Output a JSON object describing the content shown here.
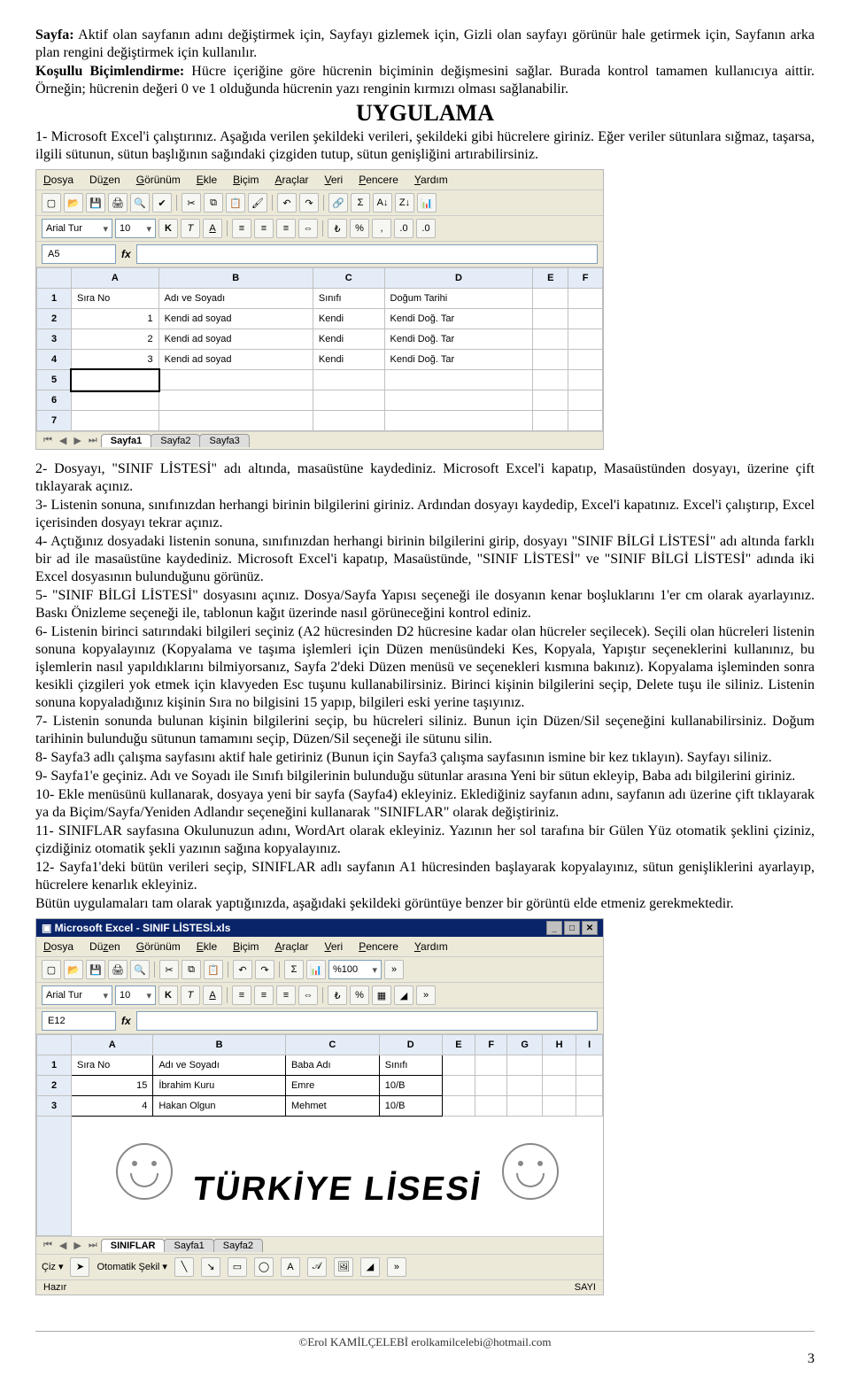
{
  "intro": {
    "p1_a": "Sayfa:",
    "p1_b": " Aktif olan sayfanın adını değiştirmek için, Sayfayı gizlemek için, Gizli olan sayfayı görünür hale getirmek için, Sayfanın arka plan rengini değiştirmek için kullanılır.",
    "p2_a": "Koşullu Biçimlendirme:",
    "p2_b": " Hücre içeriğine göre hücrenin biçiminin değişmesini sağlar. Burada kontrol tamamen kullanıcıya aittir. Örneğin; hücrenin değeri 0 ve 1 olduğunda hücrenin yazı renginin kırmızı olması sağlanabilir."
  },
  "uyg_title": "UYGULAMA",
  "uyg_p1": "1- Microsoft Excel'i çalıştırınız. Aşağıda verilen şekildeki verileri, şekildeki gibi hücrelere giriniz. Eğer veriler sütunlara sığmaz, taşarsa, ilgili sütunun, sütun başlığının sağındaki çizgiden tutup, sütun genişliğini artırabilirsiniz.",
  "excel1": {
    "menus": [
      "Dosya",
      "Düzen",
      "Görünüm",
      "Ekle",
      "Biçim",
      "Araçlar",
      "Veri",
      "Pencere",
      "Yardım"
    ],
    "font": "Arial Tur",
    "size": "10",
    "cellref": "A5",
    "fx": "fx",
    "cols": [
      "A",
      "B",
      "C",
      "D",
      "E",
      "F"
    ],
    "rows": [
      [
        "1",
        "Sıra No",
        "Adı ve Soyadı",
        "Sınıfı",
        "Doğum Tarihi",
        "",
        ""
      ],
      [
        "2",
        "1",
        "Kendi ad soyad",
        "Kendi",
        "Kendi Doğ. Tar",
        "",
        ""
      ],
      [
        "3",
        "2",
        "Kendi ad soyad",
        "Kendi",
        "Kendi Doğ. Tar",
        "",
        ""
      ],
      [
        "4",
        "3",
        "Kendi ad soyad",
        "Kendi",
        "Kendi Doğ. Tar",
        "",
        ""
      ],
      [
        "5",
        "",
        "",
        "",
        "",
        "",
        ""
      ],
      [
        "6",
        "",
        "",
        "",
        "",
        "",
        ""
      ],
      [
        "7",
        "",
        "",
        "",
        "",
        "",
        ""
      ]
    ],
    "tabs": [
      "Sayfa1",
      "Sayfa2",
      "Sayfa3"
    ]
  },
  "paras": {
    "p2": "2- Dosyayı, \"SINIF LİSTESİ\" adı altında, masaüstüne kaydediniz. Microsoft Excel'i kapatıp, Masaüstünden dosyayı, üzerine çift tıklayarak açınız.",
    "p3": "3- Listenin sonuna, sınıfınızdan herhangi birinin bilgilerini giriniz. Ardından dosyayı kaydedip, Excel'i kapatınız. Excel'i çalıştırıp, Excel içerisinden dosyayı tekrar açınız.",
    "p4": "4- Açtığınız dosyadaki listenin sonuna, sınıfınızdan herhangi birinin bilgilerini girip, dosyayı \"SINIF BİLGİ LİSTESİ\" adı altında farklı bir ad ile masaüstüne kaydediniz. Microsoft Excel'i kapatıp, Masaüstünde, \"SINIF LİSTESİ\" ve \"SINIF BİLGİ LİSTESİ\" adında iki Excel dosyasının bulunduğunu görünüz.",
    "p5": "5- \"SINIF BİLGİ LİSTESİ\" dosyasını açınız. Dosya/Sayfa Yapısı seçeneği ile dosyanın kenar boşluklarını 1'er cm olarak ayarlayınız. Baskı Önizleme seçeneği ile, tablonun kağıt üzerinde nasıl görüneceğini kontrol ediniz.",
    "p6": "6- Listenin birinci satırındaki bilgileri seçiniz (A2 hücresinden D2 hücresine kadar olan hücreler seçilecek). Seçili olan hücreleri listenin sonuna kopyalayınız (Kopyalama ve taşıma işlemleri için Düzen menüsündeki Kes, Kopyala, Yapıştır seçeneklerini kullanınız, bu işlemlerin nasıl yapıldıklarını bilmiyorsanız, Sayfa 2'deki Düzen menüsü ve seçenekleri kısmına bakınız). Kopyalama işleminden sonra kesikli çizgileri yok etmek için klavyeden Esc tuşunu kullanabilirsiniz. Birinci kişinin bilgilerini seçip, Delete tuşu ile siliniz. Listenin sonuna kopyaladığınız kişinin Sıra no bilgisini 15 yapıp, bilgileri eski yerine taşıyınız.",
    "p7": "7- Listenin sonunda bulunan kişinin bilgilerini seçip, bu hücreleri siliniz. Bunun için Düzen/Sil seçeneğini kullanabilirsiniz. Doğum tarihinin bulunduğu sütunun tamamını seçip, Düzen/Sil seçeneği ile sütunu silin.",
    "p8": "8- Sayfa3 adlı çalışma sayfasını aktif hale getiriniz (Bunun için Sayfa3 çalışma sayfasının ismine bir kez tıklayın). Sayfayı siliniz.",
    "p9": "9- Sayfa1'e geçiniz. Adı ve Soyadı ile Sınıfı bilgilerinin bulunduğu sütunlar arasına Yeni bir sütun ekleyip, Baba adı bilgilerini giriniz.",
    "p10": "10- Ekle menüsünü kullanarak, dosyaya yeni bir sayfa (Sayfa4) ekleyiniz. Eklediğiniz sayfanın adını, sayfanın adı üzerine çift tıklayarak ya da Biçim/Sayfa/Yeniden Adlandır seçeneğini kullanarak \"SINIFLAR\" olarak değiştiriniz.",
    "p11": "11- SINIFLAR sayfasına Okulunuzun adını, WordArt olarak ekleyiniz. Yazının her sol tarafına bir Gülen Yüz otomatik şeklini çiziniz, çizdiğiniz otomatik şekli yazının sağına kopyalayınız.",
    "p12": "12- Sayfa1'deki bütün verileri seçip, SINIFLAR adlı sayfanın A1 hücresinden başlayarak kopyalayınız, sütun genişliklerini ayarlayıp, hücrelere kenarlık ekleyiniz.",
    "p13": "Bütün uygulamaları tam olarak yaptığınızda, aşağıdaki şekildeki görüntüye benzer bir görüntü elde etmeniz gerekmektedir."
  },
  "excel2": {
    "title": "Microsoft Excel - SINIF LİSTESİ.xls",
    "menus": [
      "Dosya",
      "Düzen",
      "Görünüm",
      "Ekle",
      "Biçim",
      "Araçlar",
      "Veri",
      "Pencere",
      "Yardım"
    ],
    "font": "Arial Tur",
    "size": "10",
    "cellref": "E12",
    "fx": "fx",
    "zoom": "%100",
    "cols": [
      "A",
      "B",
      "C",
      "D",
      "E",
      "F",
      "G",
      "H",
      "I"
    ],
    "rows": [
      [
        "1",
        "Sıra No",
        "Adı ve Soyadı",
        "Baba Adı",
        "Sınıfı",
        "",
        "",
        "",
        "",
        ""
      ],
      [
        "2",
        "15",
        "İbrahim Kuru",
        "Emre",
        "10/B",
        "",
        "",
        "",
        "",
        ""
      ],
      [
        "3",
        "4",
        "Hakan Olgun",
        "Mehmet",
        "10/B",
        "",
        "",
        "",
        "",
        ""
      ]
    ],
    "wordart": "TÜRKİYE LİSESİ",
    "tabs": [
      "SINIFLAR",
      "Sayfa1",
      "Sayfa2"
    ],
    "draw": "Çiz ▾",
    "autoshape": "Otomatik Şekil ▾",
    "status_l": "Hazır",
    "status_r": "SAYI"
  },
  "footer": "©Erol KAMİLÇELEBİ erolkamilcelebi@hotmail.com",
  "page": "3"
}
